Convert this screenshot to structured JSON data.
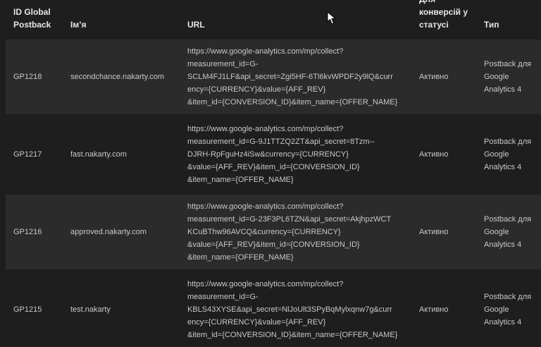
{
  "table": {
    "headers": {
      "id": "ID Global\nPostback",
      "name": "Ім’я",
      "url": "URL",
      "status": "Для\nконверсій у\nстатусі",
      "type": "Тип"
    },
    "rows": [
      {
        "id": "GP1218",
        "name": "secondchance.nakarty.com",
        "url": "https://www.google-analytics.com/mp/collect?\nmeasurement_id=G-\nSCLM4FJ1LF&api_secret=Zgi5HF-6Tl6kvWPDF2y9lQ&curr\nency={CURRENCY}&value={AFF_REV}\n&item_id={CONVERSION_ID}&item_name={OFFER_NAME}",
        "status": "Активно",
        "type": "Postback для\nGoogle\nAnalytics 4"
      },
      {
        "id": "GP1217",
        "name": "fast.nakarty.com",
        "url": "https://www.google-analytics.com/mp/collect?\nmeasurement_id=G-9J1TTZQ2ZT&api_secret=8Tzm--\nDJRH-RpFguHz4iSw&currency={CURRENCY}\n&value={AFF_REV}&item_id={CONVERSION_ID}\n&item_name={OFFER_NAME}",
        "status": "Активно",
        "type": "Postback для\nGoogle\nAnalytics 4"
      },
      {
        "id": "GP1216",
        "name": "approved.nakarty.com",
        "url": "https://www.google-analytics.com/mp/collect?\nmeasurement_id=G-23F3PL6TZN&api_secret=AkjhpzWCT\nKCuBThw96AVCQ&currency={CURRENCY}\n&value={AFF_REV}&item_id={CONVERSION_ID}\n&item_name={OFFER_NAME}",
        "status": "Активно",
        "type": "Postback для\nGoogle\nAnalytics 4"
      },
      {
        "id": "GP1215",
        "name": "test.nakarty",
        "url": "https://www.google-analytics.com/mp/collect?\nmeasurement_id=G-\nKBLS43XYSE&api_secret=NlJoUlt3SPyBqMylxqnw7g&curr\nency={CURRENCY}&value={AFF_REV}\n&item_id={CONVERSION_ID}&item_name={OFFER_NAME}",
        "status": "Активно",
        "type": "Postback для\nGoogle\nAnalytics 4"
      }
    ]
  },
  "cursor": {
    "icon": "mouse-pointer-icon"
  }
}
